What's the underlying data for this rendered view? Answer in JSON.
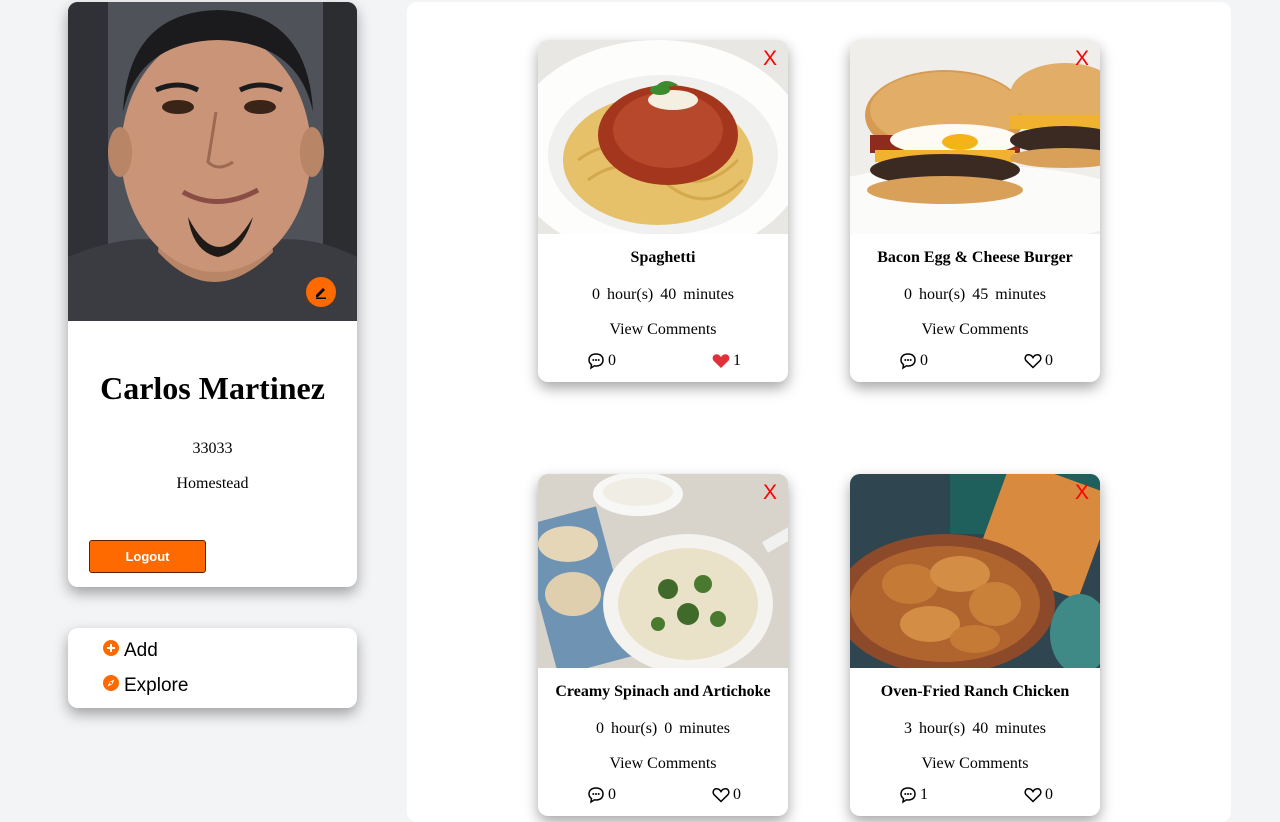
{
  "profile": {
    "name": "Carlos Martinez",
    "zip": "33033",
    "city": "Homestead",
    "logout_label": "Logout"
  },
  "nav": {
    "items": [
      {
        "label": "Add",
        "icon": "plus-circle-icon"
      },
      {
        "label": "Explore",
        "icon": "compass-icon"
      }
    ]
  },
  "recipes": [
    {
      "title": "Spaghetti",
      "hours": "0",
      "minutes": "40",
      "hours_unit": "hour(s)",
      "minutes_unit": "minutes",
      "view_comments": "View Comments",
      "comments": "0",
      "likes": "1",
      "liked": true,
      "delete": "X"
    },
    {
      "title": "Bacon Egg & Cheese Burger",
      "hours": "0",
      "minutes": "45",
      "hours_unit": "hour(s)",
      "minutes_unit": "minutes",
      "view_comments": "View Comments",
      "comments": "0",
      "likes": "0",
      "liked": false,
      "delete": "X"
    },
    {
      "title": "Creamy Spinach and Artichoke",
      "hours": "0",
      "minutes": "0",
      "hours_unit": "hour(s)",
      "minutes_unit": "minutes",
      "view_comments": "View Comments",
      "comments": "0",
      "likes": "0",
      "liked": false,
      "delete": "X"
    },
    {
      "title": "Oven-Fried Ranch Chicken",
      "hours": "3",
      "minutes": "40",
      "hours_unit": "hour(s)",
      "minutes_unit": "minutes",
      "view_comments": "View Comments",
      "comments": "1",
      "likes": "0",
      "liked": false,
      "delete": "X"
    }
  ],
  "colors": {
    "accent": "#ff6a00",
    "delete": "#ff0000",
    "liked_heart": "#e0303a",
    "page_bg": "#f3f4f6"
  }
}
